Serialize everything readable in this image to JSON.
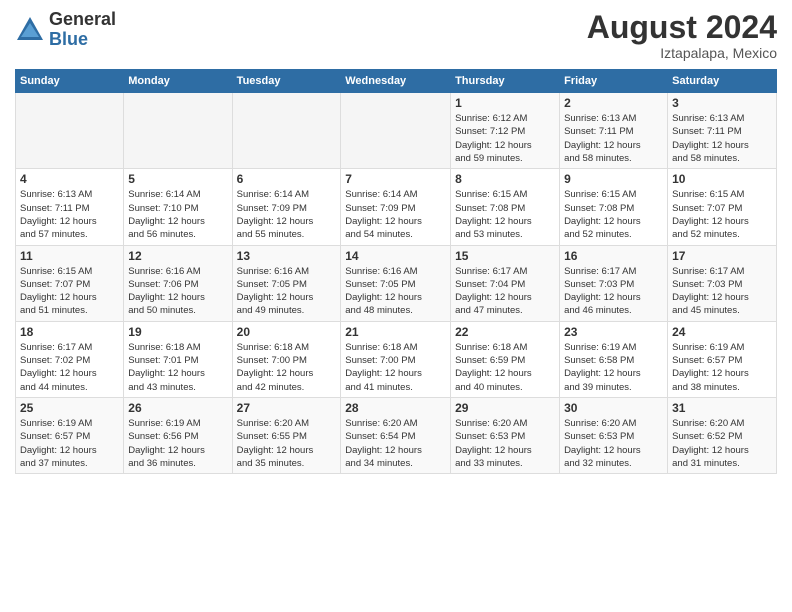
{
  "header": {
    "logo": {
      "general": "General",
      "blue": "Blue"
    },
    "title": "August 2024",
    "location": "Iztapalapa, Mexico"
  },
  "weekdays": [
    "Sunday",
    "Monday",
    "Tuesday",
    "Wednesday",
    "Thursday",
    "Friday",
    "Saturday"
  ],
  "weeks": [
    [
      {
        "day": "",
        "info": ""
      },
      {
        "day": "",
        "info": ""
      },
      {
        "day": "",
        "info": ""
      },
      {
        "day": "",
        "info": ""
      },
      {
        "day": "1",
        "info": "Sunrise: 6:12 AM\nSunset: 7:12 PM\nDaylight: 12 hours\nand 59 minutes."
      },
      {
        "day": "2",
        "info": "Sunrise: 6:13 AM\nSunset: 7:11 PM\nDaylight: 12 hours\nand 58 minutes."
      },
      {
        "day": "3",
        "info": "Sunrise: 6:13 AM\nSunset: 7:11 PM\nDaylight: 12 hours\nand 58 minutes."
      }
    ],
    [
      {
        "day": "4",
        "info": "Sunrise: 6:13 AM\nSunset: 7:11 PM\nDaylight: 12 hours\nand 57 minutes."
      },
      {
        "day": "5",
        "info": "Sunrise: 6:14 AM\nSunset: 7:10 PM\nDaylight: 12 hours\nand 56 minutes."
      },
      {
        "day": "6",
        "info": "Sunrise: 6:14 AM\nSunset: 7:09 PM\nDaylight: 12 hours\nand 55 minutes."
      },
      {
        "day": "7",
        "info": "Sunrise: 6:14 AM\nSunset: 7:09 PM\nDaylight: 12 hours\nand 54 minutes."
      },
      {
        "day": "8",
        "info": "Sunrise: 6:15 AM\nSunset: 7:08 PM\nDaylight: 12 hours\nand 53 minutes."
      },
      {
        "day": "9",
        "info": "Sunrise: 6:15 AM\nSunset: 7:08 PM\nDaylight: 12 hours\nand 52 minutes."
      },
      {
        "day": "10",
        "info": "Sunrise: 6:15 AM\nSunset: 7:07 PM\nDaylight: 12 hours\nand 52 minutes."
      }
    ],
    [
      {
        "day": "11",
        "info": "Sunrise: 6:15 AM\nSunset: 7:07 PM\nDaylight: 12 hours\nand 51 minutes."
      },
      {
        "day": "12",
        "info": "Sunrise: 6:16 AM\nSunset: 7:06 PM\nDaylight: 12 hours\nand 50 minutes."
      },
      {
        "day": "13",
        "info": "Sunrise: 6:16 AM\nSunset: 7:05 PM\nDaylight: 12 hours\nand 49 minutes."
      },
      {
        "day": "14",
        "info": "Sunrise: 6:16 AM\nSunset: 7:05 PM\nDaylight: 12 hours\nand 48 minutes."
      },
      {
        "day": "15",
        "info": "Sunrise: 6:17 AM\nSunset: 7:04 PM\nDaylight: 12 hours\nand 47 minutes."
      },
      {
        "day": "16",
        "info": "Sunrise: 6:17 AM\nSunset: 7:03 PM\nDaylight: 12 hours\nand 46 minutes."
      },
      {
        "day": "17",
        "info": "Sunrise: 6:17 AM\nSunset: 7:03 PM\nDaylight: 12 hours\nand 45 minutes."
      }
    ],
    [
      {
        "day": "18",
        "info": "Sunrise: 6:17 AM\nSunset: 7:02 PM\nDaylight: 12 hours\nand 44 minutes."
      },
      {
        "day": "19",
        "info": "Sunrise: 6:18 AM\nSunset: 7:01 PM\nDaylight: 12 hours\nand 43 minutes."
      },
      {
        "day": "20",
        "info": "Sunrise: 6:18 AM\nSunset: 7:00 PM\nDaylight: 12 hours\nand 42 minutes."
      },
      {
        "day": "21",
        "info": "Sunrise: 6:18 AM\nSunset: 7:00 PM\nDaylight: 12 hours\nand 41 minutes."
      },
      {
        "day": "22",
        "info": "Sunrise: 6:18 AM\nSunset: 6:59 PM\nDaylight: 12 hours\nand 40 minutes."
      },
      {
        "day": "23",
        "info": "Sunrise: 6:19 AM\nSunset: 6:58 PM\nDaylight: 12 hours\nand 39 minutes."
      },
      {
        "day": "24",
        "info": "Sunrise: 6:19 AM\nSunset: 6:57 PM\nDaylight: 12 hours\nand 38 minutes."
      }
    ],
    [
      {
        "day": "25",
        "info": "Sunrise: 6:19 AM\nSunset: 6:57 PM\nDaylight: 12 hours\nand 37 minutes."
      },
      {
        "day": "26",
        "info": "Sunrise: 6:19 AM\nSunset: 6:56 PM\nDaylight: 12 hours\nand 36 minutes."
      },
      {
        "day": "27",
        "info": "Sunrise: 6:20 AM\nSunset: 6:55 PM\nDaylight: 12 hours\nand 35 minutes."
      },
      {
        "day": "28",
        "info": "Sunrise: 6:20 AM\nSunset: 6:54 PM\nDaylight: 12 hours\nand 34 minutes."
      },
      {
        "day": "29",
        "info": "Sunrise: 6:20 AM\nSunset: 6:53 PM\nDaylight: 12 hours\nand 33 minutes."
      },
      {
        "day": "30",
        "info": "Sunrise: 6:20 AM\nSunset: 6:53 PM\nDaylight: 12 hours\nand 32 minutes."
      },
      {
        "day": "31",
        "info": "Sunrise: 6:20 AM\nSunset: 6:52 PM\nDaylight: 12 hours\nand 31 minutes."
      }
    ]
  ]
}
